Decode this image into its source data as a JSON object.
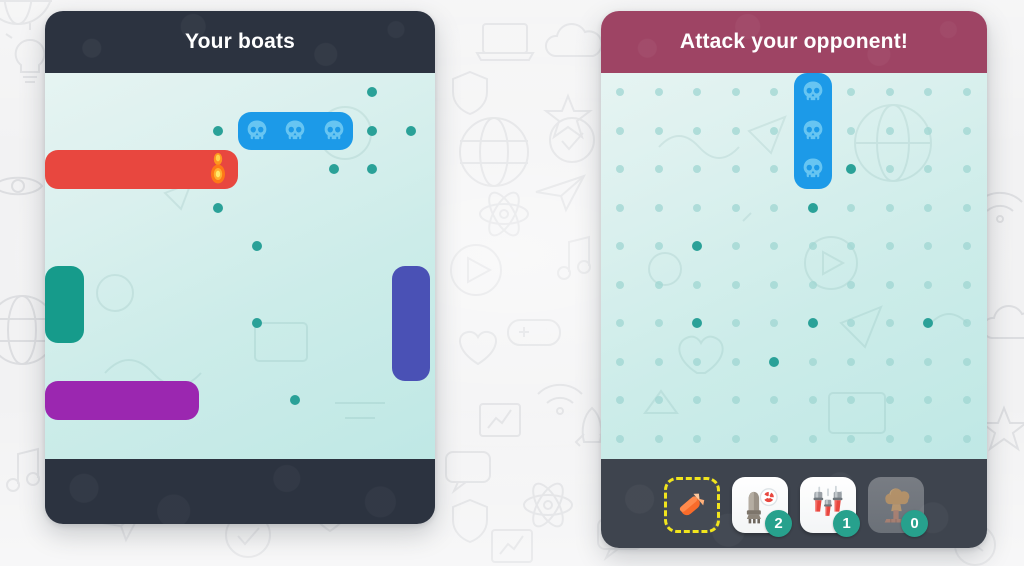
{
  "app": {
    "background_color": "#f2f2f3"
  },
  "boards": {
    "own": {
      "title": "Your boats",
      "header_color": "#2c3340",
      "grid": {
        "cols": 10,
        "rows": 10,
        "cell": 38.5
      },
      "show_grid_dots": false,
      "ships": [
        {
          "name": "ship-blue-sunk",
          "color": "#1c9ae8",
          "orientation": "horizontal",
          "col": 5,
          "row": 1,
          "length": 3,
          "sunk": true,
          "hits": []
        },
        {
          "name": "ship-red",
          "color": "#e8473f",
          "orientation": "horizontal",
          "col": 0,
          "row": 2,
          "length": 5,
          "sunk": false,
          "hits": [
            4
          ]
        },
        {
          "name": "ship-teal",
          "color": "#169b8b",
          "orientation": "vertical",
          "col": 0,
          "row": 5,
          "length": 2,
          "sunk": false,
          "hits": []
        },
        {
          "name": "ship-indigo",
          "color": "#4a51b5",
          "orientation": "vertical",
          "col": 9,
          "row": 5,
          "length": 3,
          "sunk": false,
          "hits": []
        },
        {
          "name": "ship-purple",
          "color": "#9b27b0",
          "orientation": "horizontal",
          "col": 0,
          "row": 8,
          "length": 4,
          "sunk": false,
          "hits": []
        }
      ],
      "misses": [
        {
          "col": 8,
          "row": 0
        },
        {
          "col": 4,
          "row": 1
        },
        {
          "col": 8,
          "row": 1
        },
        {
          "col": 9,
          "row": 1
        },
        {
          "col": 4,
          "row": 3
        },
        {
          "col": 7,
          "row": 2
        },
        {
          "col": 8,
          "row": 2
        },
        {
          "col": 5,
          "row": 4
        },
        {
          "col": 5,
          "row": 6
        },
        {
          "col": 6,
          "row": 8
        }
      ]
    },
    "enemy": {
      "title": "Attack your opponent!",
      "header_color": "#9e4464",
      "grid": {
        "cols": 10,
        "rows": 10,
        "cell": 38.5
      },
      "show_grid_dots": true,
      "ships": [
        {
          "name": "ship-blue-sunk",
          "color": "#1c9ae8",
          "orientation": "vertical",
          "col": 5,
          "row": 0,
          "length": 3,
          "sunk": true,
          "hits": []
        }
      ],
      "misses": [
        {
          "col": 6,
          "row": 2
        },
        {
          "col": 5,
          "row": 3
        },
        {
          "col": 2,
          "row": 4
        },
        {
          "col": 2,
          "row": 6
        },
        {
          "col": 5,
          "row": 6
        },
        {
          "col": 8,
          "row": 6
        },
        {
          "col": 4,
          "row": 7
        }
      ]
    }
  },
  "weapons": {
    "items": [
      {
        "id": "missile",
        "icon": "missile-icon",
        "label": "Missile",
        "count": null,
        "selected": true,
        "enabled": true,
        "style": "plain"
      },
      {
        "id": "nuke-rocket",
        "icon": "nuclear-rocket-icon",
        "label": "Nuke rocket",
        "count": "2",
        "selected": false,
        "enabled": true,
        "style": "tile"
      },
      {
        "id": "air-strike",
        "icon": "bomb-salvo-icon",
        "label": "Air strike",
        "count": "1",
        "selected": false,
        "enabled": true,
        "style": "tile"
      },
      {
        "id": "atom-bomb",
        "icon": "mushroom-cloud-icon",
        "label": "Atom bomb",
        "count": "0",
        "selected": false,
        "enabled": false,
        "style": "tile"
      }
    ],
    "badge_color": "#27a18d",
    "selection_color": "#f2e51d"
  }
}
